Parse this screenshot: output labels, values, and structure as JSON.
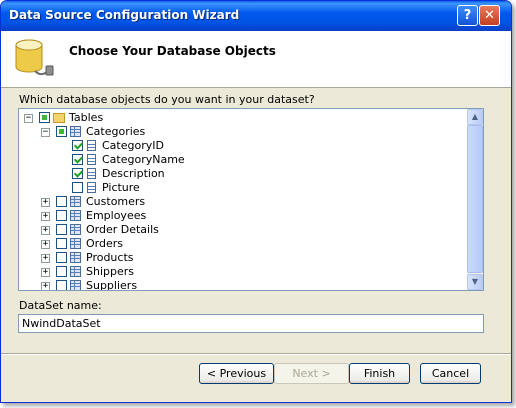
{
  "window": {
    "title": "Data Source Configuration Wizard"
  },
  "header": {
    "title": "Choose Your Database Objects",
    "icon": "database-icon"
  },
  "prompt": "Which database objects do you want in your dataset?",
  "tree": {
    "root": {
      "label": "Tables",
      "state": "partial",
      "expanded": true
    },
    "categories": {
      "label": "Categories",
      "state": "partial",
      "expanded": true
    },
    "fields": [
      {
        "label": "CategoryID",
        "checked": true
      },
      {
        "label": "CategoryName",
        "checked": true
      },
      {
        "label": "Description",
        "checked": true
      },
      {
        "label": "Picture",
        "checked": false
      }
    ],
    "tables": [
      {
        "label": "Customers",
        "checked": false
      },
      {
        "label": "Employees",
        "checked": false
      },
      {
        "label": "Order Details",
        "checked": false
      },
      {
        "label": "Orders",
        "checked": false
      },
      {
        "label": "Products",
        "checked": false
      },
      {
        "label": "Shippers",
        "checked": false
      },
      {
        "label": "Suppliers",
        "checked": false
      }
    ]
  },
  "dataset": {
    "label": "DataSet name:",
    "value": "NwindDataSet"
  },
  "buttons": {
    "previous": "< Previous",
    "next": "Next >",
    "finish": "Finish",
    "cancel": "Cancel"
  }
}
